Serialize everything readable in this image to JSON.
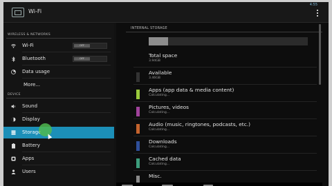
{
  "actionbar": {
    "title": "Wi-Fi",
    "status_text": "4:55"
  },
  "left": {
    "sections": [
      {
        "header": "WIRELESS & NETWORKS"
      },
      {
        "header": "DEVICE"
      }
    ],
    "wireless_items": [
      {
        "label": "Wi-Fi",
        "icon": "wifi-icon",
        "toggle": "OFF"
      },
      {
        "label": "Bluetooth",
        "icon": "bluetooth-icon",
        "toggle": "OFF"
      },
      {
        "label": "Data usage",
        "icon": "data-usage-icon"
      },
      {
        "label": "More...",
        "icon": ""
      }
    ],
    "device_items": [
      {
        "label": "Sound",
        "icon": "sound-icon"
      },
      {
        "label": "Display",
        "icon": "display-icon"
      },
      {
        "label": "Storage",
        "icon": "storage-icon",
        "active": true
      },
      {
        "label": "Battery",
        "icon": "battery-icon"
      },
      {
        "label": "Apps",
        "icon": "apps-icon"
      },
      {
        "label": "Users",
        "icon": "users-icon"
      }
    ]
  },
  "right": {
    "header": "INTERNAL STORAGE",
    "bar_fraction": 0.12,
    "rows": [
      {
        "title": "Total space",
        "sub": "3.94GB",
        "color": ""
      },
      {
        "title": "Available",
        "sub": "3.46GB",
        "color": "#333333"
      },
      {
        "title": "Apps (app data & media content)",
        "sub": "Calculating...",
        "color": "#9ac93c"
      },
      {
        "title": "Pictures, videos",
        "sub": "Calculating...",
        "color": "#a0429b"
      },
      {
        "title": "Audio (music, ringtones, podcasts, etc.)",
        "sub": "Calculating...",
        "color": "#c4632d"
      },
      {
        "title": "Downloads",
        "sub": "Calculating...",
        "color": "#2f4f9a"
      },
      {
        "title": "Cached data",
        "sub": "Calculating...",
        "color": "#3c9d7c"
      },
      {
        "title": "Misc.",
        "sub": "",
        "color": "#8a8a8a"
      }
    ]
  },
  "colors": {
    "accent": "#1c8fb8",
    "touch": "#4fb84f"
  }
}
